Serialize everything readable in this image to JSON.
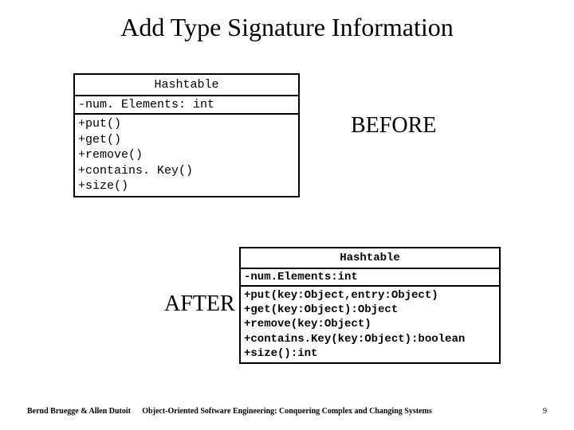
{
  "title": "Add Type Signature Information",
  "before": {
    "label": "BEFORE",
    "class_name": "Hashtable",
    "attributes": "-num. Elements: int",
    "operations": [
      "+put()",
      "+get()",
      "+remove()",
      "+contains. Key()",
      "+size()"
    ]
  },
  "after": {
    "label": "AFTER",
    "class_name": "Hashtable",
    "attributes": "-num.Elements:int",
    "operations": [
      "+put(key:Object,entry:Object)",
      "+get(key:Object):Object",
      "+remove(key:Object)",
      "+contains.Key(key:Object):boolean",
      "+size():int"
    ]
  },
  "footer": {
    "left": "Bernd Bruegge & Allen Dutoit",
    "center": "Object-Oriented Software Engineering: Conquering Complex and Changing Systems",
    "right": "9"
  }
}
